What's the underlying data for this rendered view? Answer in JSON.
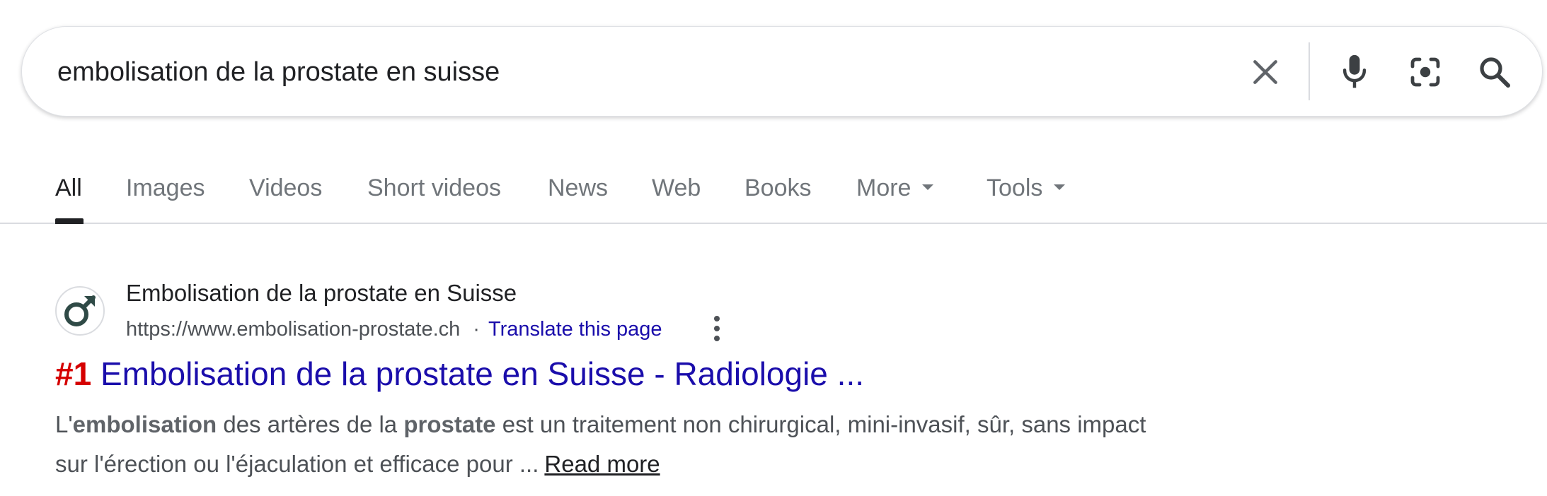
{
  "search": {
    "query": "embolisation de la prostate en suisse"
  },
  "icons": {
    "clear": "close-icon",
    "voice": "microphone-icon",
    "lens": "camera-lens-icon",
    "search": "search-icon",
    "favicon": "male-symbol-icon",
    "more_options": "more-vert-icon"
  },
  "tabs": [
    {
      "label": "All",
      "active": true
    },
    {
      "label": "Images"
    },
    {
      "label": "Videos"
    },
    {
      "label": "Short videos"
    },
    {
      "label": "News"
    },
    {
      "label": "Web"
    },
    {
      "label": "Books"
    },
    {
      "label": "More"
    },
    {
      "label": "Tools"
    }
  ],
  "result": {
    "site_name": "Embolisation de la prostate en Suisse",
    "url": "https://www.embolisation-prostate.ch",
    "separator": "·",
    "translate_label": "Translate this page",
    "title_rank": "#1",
    "title_text": " Embolisation de la prostate en Suisse - Radiologie ...",
    "snippet": {
      "p1": "L'",
      "b1": "embolisation",
      "p2": " des artères de la ",
      "b2": "prostate",
      "p3": " est un traitement non chirurgical, mini-invasif, sûr, sans impact sur l'érection ou l'éjaculation et efficace pour ...",
      "read_more": "Read more"
    }
  },
  "colors": {
    "link": "#1a0dab",
    "rank": "#d50000",
    "muted_text": "#70757a",
    "text": "#202124",
    "divider": "#dadce0"
  }
}
